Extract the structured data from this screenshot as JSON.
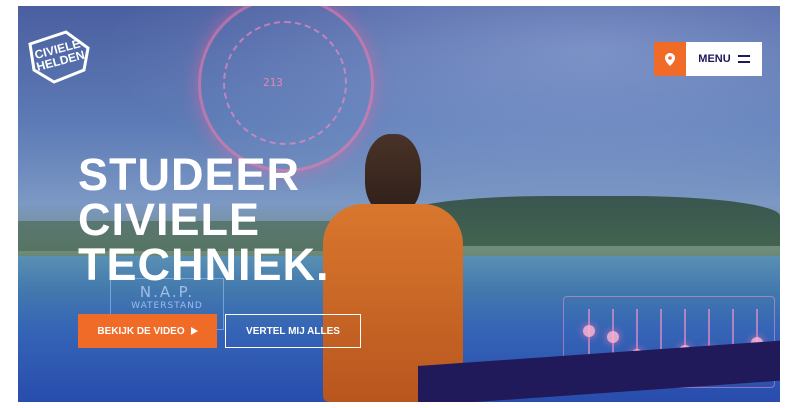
{
  "logo": {
    "line1": "CIVIELE",
    "line2": "HELDEN"
  },
  "header": {
    "menu_label": "MENU"
  },
  "hero": {
    "headline": [
      "STUDEER",
      "CIVIELE",
      "TECHNIEK."
    ],
    "primary_button": "BEKIJK DE VIDEO",
    "secondary_button": "VERTEL MIJ ALLES"
  },
  "hologram": {
    "nap": "N.A.P.",
    "waterstand": "WATERSTAND",
    "dial_value": "213"
  },
  "icons": {
    "location": "location-pin-icon",
    "menu": "hamburger-icon",
    "play": "play-arrow-icon"
  },
  "colors": {
    "accent": "#f06a28",
    "navy": "#1d1a5a",
    "white": "#ffffff"
  }
}
